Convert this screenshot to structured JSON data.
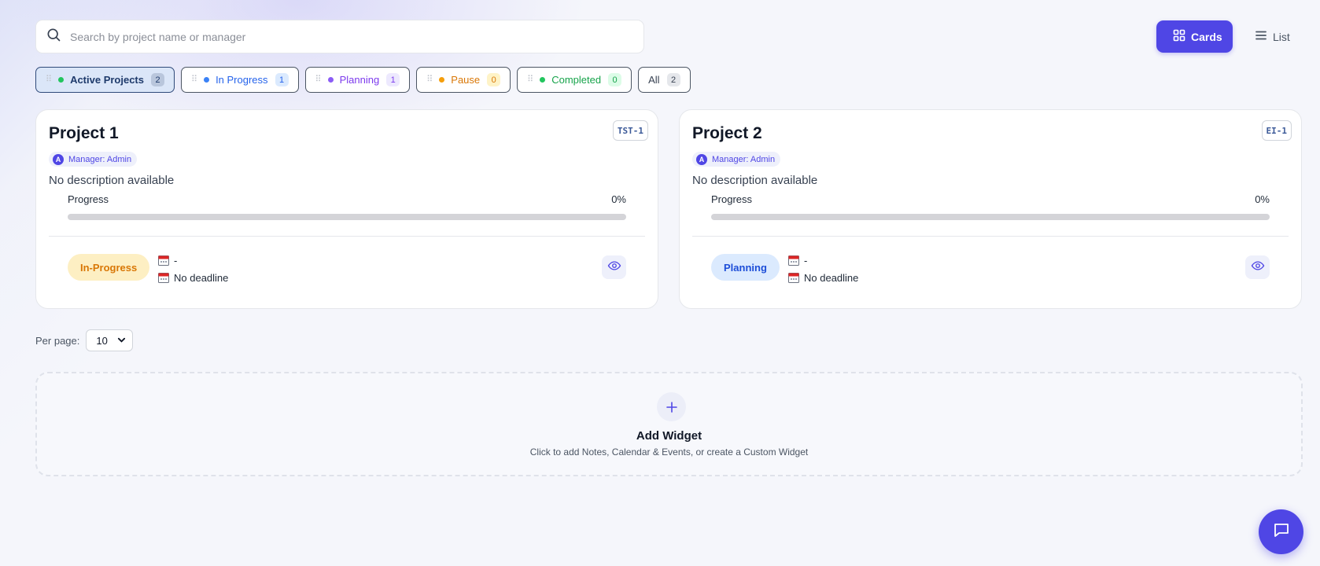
{
  "search": {
    "placeholder": "Search by project name or manager",
    "value": ""
  },
  "view_toggle": {
    "cards_label": "Cards",
    "list_label": "List",
    "active": "cards",
    "accent_color": "#4f46e5"
  },
  "filters": [
    {
      "label": "Active Projects",
      "count": "2",
      "dot_color": "#22c55e",
      "text_color": "#1e3a6b",
      "count_bg": "#b9c6dc",
      "active": true
    },
    {
      "label": "In Progress",
      "count": "1",
      "dot_color": "#3b82f6",
      "text_color": "#2563eb",
      "count_bg": "#dbeafe",
      "active": false
    },
    {
      "label": "Planning",
      "count": "1",
      "dot_color": "#8b5cf6",
      "text_color": "#7c3aed",
      "count_bg": "#ede9fe",
      "active": false
    },
    {
      "label": "Pause",
      "count": "0",
      "dot_color": "#f59e0b",
      "text_color": "#d97706",
      "count_bg": "#fef3c7",
      "active": false
    },
    {
      "label": "Completed",
      "count": "0",
      "dot_color": "#22c55e",
      "text_color": "#16a34a",
      "count_bg": "#dcfce7",
      "active": false
    },
    {
      "label": "All",
      "count": "2",
      "dot_color": null,
      "text_color": "#374151",
      "count_bg": "#e5e7eb",
      "active": false
    }
  ],
  "projects": [
    {
      "title": "Project 1",
      "code": "TST-1",
      "manager": "Manager: Admin",
      "manager_initial": "A",
      "description": "No description available",
      "progress_label": "Progress",
      "progress_text": "0%",
      "progress": 0,
      "status": "In-Progress",
      "status_bg": "#fdefc3",
      "status_color": "#d97706",
      "start": "-",
      "deadline": "No deadline"
    },
    {
      "title": "Project 2",
      "code": "EI-1",
      "manager": "Manager: Admin",
      "manager_initial": "A",
      "description": "No description available",
      "progress_label": "Progress",
      "progress_text": "0%",
      "progress": 0,
      "status": "Planning",
      "status_bg": "#dbeafe",
      "status_color": "#1d4ed8",
      "start": "-",
      "deadline": "No deadline"
    }
  ],
  "pagination": {
    "per_page_label": "Per page:",
    "per_page_value": "10"
  },
  "widget": {
    "title": "Add Widget",
    "subtitle": "Click to add Notes, Calendar & Events, or create a Custom Widget"
  },
  "icons": {
    "search": "search-icon",
    "cards": "grid-icon",
    "list": "list-icon",
    "calendar": "calendar-icon",
    "view": "eye-icon",
    "add": "plus-icon",
    "chat": "chat-icon"
  }
}
